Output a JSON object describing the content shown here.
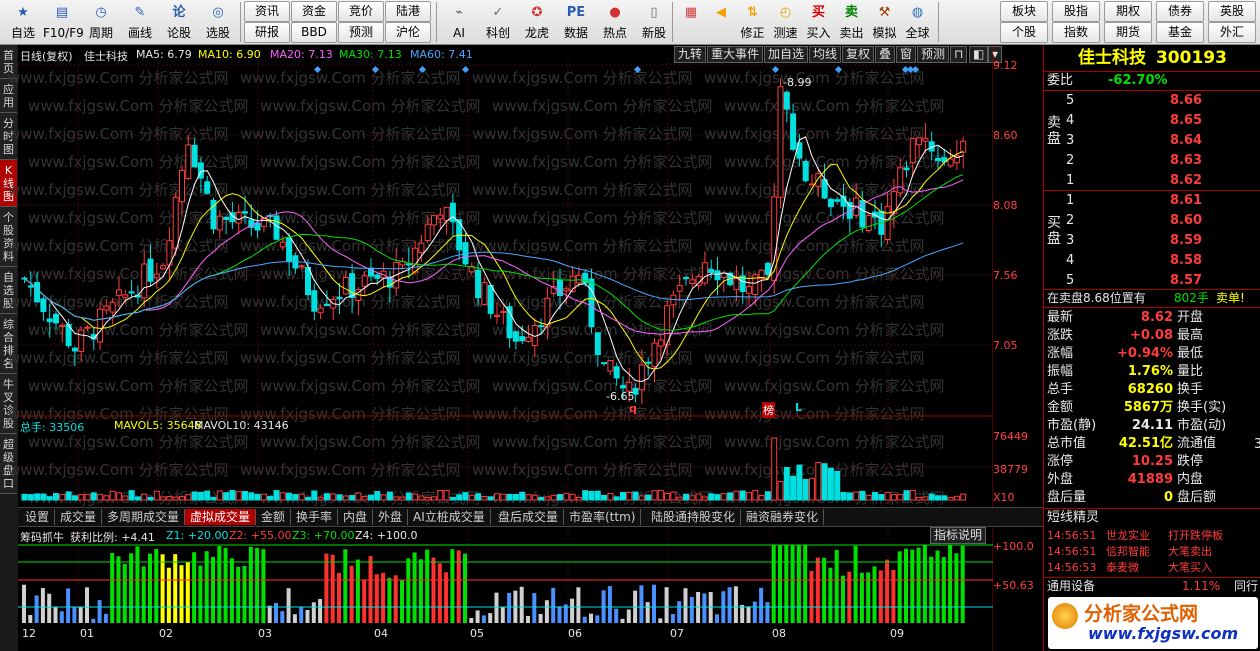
{
  "toolbar": {
    "left_buttons": [
      {
        "label": "自选",
        "icon": "star-icon",
        "sub": ""
      },
      {
        "label": "F10/F9",
        "icon": "f10-icon",
        "sub": ""
      },
      {
        "label": "周期",
        "icon": "clock-icon",
        "sub": ""
      },
      {
        "label": "画线",
        "icon": "pen-icon",
        "sub": ""
      },
      {
        "label": "论股",
        "icon": "discuss-icon",
        "sub": ""
      },
      {
        "label": "选股",
        "icon": "filter-icon",
        "sub": ""
      }
    ],
    "small_buttons": [
      [
        "资讯",
        "资金",
        "竞价",
        "陆港"
      ],
      [
        "研报",
        "BBD",
        "预测",
        "沪伦"
      ]
    ],
    "mid_buttons": [
      {
        "label": "AI",
        "icon": "ai-icon"
      },
      {
        "label": "科创",
        "icon": "kechuang-icon"
      },
      {
        "label": "龙虎",
        "icon": "dragon-tiger-icon"
      },
      {
        "label": "数据",
        "icon": "pe-icon"
      },
      {
        "label": "热点",
        "icon": "hot-icon"
      },
      {
        "label": "新股",
        "icon": "new-stock-icon"
      }
    ],
    "right_buttons": [
      {
        "label": "",
        "icon": "color-grid-icon"
      },
      {
        "label": "",
        "icon": "back-arrow-icon"
      },
      {
        "label": "修正",
        "icon": "up-down-icon"
      },
      {
        "label": "测速",
        "icon": "speed-icon"
      },
      {
        "label": "买入",
        "icon": "buy-icon",
        "glyph": "买"
      },
      {
        "label": "卖出",
        "icon": "sell-icon",
        "glyph": "卖"
      },
      {
        "label": "模拟",
        "icon": "hammer-icon"
      },
      {
        "label": "全球",
        "icon": "globe-icon"
      }
    ],
    "right_small": [
      [
        "板块",
        "股指",
        "期权",
        "债券",
        "英股"
      ],
      [
        "个股",
        "指数",
        "期货",
        "基金",
        "外汇"
      ]
    ]
  },
  "sidebar": {
    "tabs": [
      {
        "label": "首页",
        "active": false
      },
      {
        "label": "应用",
        "active": false
      },
      {
        "label": "分时图",
        "active": false
      },
      {
        "label": "K线图",
        "active": true
      },
      {
        "label": "个股资料",
        "active": false
      },
      {
        "label": "自选股",
        "active": false
      },
      {
        "label": "综合排名",
        "active": false
      },
      {
        "label": "牛叉诊股",
        "active": false
      },
      {
        "label": "超级盘口",
        "active": false
      }
    ]
  },
  "chart": {
    "header": {
      "period": "日线(复权)",
      "stock": "佳士科技",
      "ma5": "MA5: 6.79",
      "ma10": "MA10: 6.90",
      "ma20": "MA20: 7.13",
      "ma30": "MA30: 7.13",
      "ma60": "MA60: 7.41"
    },
    "top_right_tools": [
      "九转",
      "重大事件",
      "加自选",
      "均线",
      "复权",
      "叠",
      "窗",
      "预测"
    ],
    "price_axis": [
      "9.12",
      "8.60",
      "8.08",
      "7.56",
      "7.05"
    ],
    "price_high": "8.99",
    "price_low": "6.65",
    "markers": {
      "q": "q",
      "bang": "榜",
      "L": "L"
    },
    "volume": {
      "total": "总手: 33506",
      "mavol5": "MAVOL5: 35648",
      "mavol10": "MAVOL10: 43146",
      "axis": [
        "76449",
        "38779",
        "X10"
      ]
    },
    "indicator_tabs": [
      "设置",
      "成交量",
      "多周期成交量",
      "虚拟成交量",
      "金额",
      "换手率",
      "内盘",
      "外盘",
      "AI立桩成交量",
      "盘后成交量",
      "市盈率(ttm)",
      "陆股通持股变化",
      "融资融券变化"
    ],
    "active_indicator": "虚拟成交量",
    "indicator": {
      "name": "筹码抓牛",
      "profit": "获利比例: +4.41",
      "z1": "Z1: +20.00",
      "z2": "Z2: +55.00",
      "z3": "Z3: +70.00",
      "z4": "Z4: +100.0",
      "help": "指标说明",
      "axis": [
        "+100.0",
        "+50.63"
      ]
    },
    "months": [
      "12",
      "01",
      "02",
      "03",
      "04",
      "05",
      "06",
      "07",
      "08",
      "09"
    ],
    "watermark": "www.fxjgsw.Com 分析家公式网"
  },
  "quote": {
    "name": "佳士科技",
    "code": "300193",
    "weibi_label": "委比",
    "weibi": "-62.70%",
    "sell_label": "卖盘",
    "buy_label": "买盘",
    "asks": [
      {
        "level": "5",
        "price": "8.66"
      },
      {
        "level": "4",
        "price": "8.65"
      },
      {
        "level": "3",
        "price": "8.64"
      },
      {
        "level": "2",
        "price": "8.63"
      },
      {
        "level": "1",
        "price": "8.62"
      }
    ],
    "bids": [
      {
        "level": "1",
        "price": "8.61"
      },
      {
        "level": "2",
        "price": "8.60"
      },
      {
        "level": "3",
        "price": "8.59"
      },
      {
        "level": "4",
        "price": "8.58"
      },
      {
        "level": "5",
        "price": "8.57"
      }
    ],
    "order_note": "在卖盘8.68位置有",
    "order_qty": "802手",
    "order_tag": "卖单!",
    "stats_left": [
      {
        "label": "最新",
        "value": "8.62",
        "color": "c-red"
      },
      {
        "label": "涨跌",
        "value": "+0.08",
        "color": "c-red"
      },
      {
        "label": "涨幅",
        "value": "+0.94%",
        "color": "c-red"
      },
      {
        "label": "振幅",
        "value": "1.76%",
        "color": "c-yellow"
      },
      {
        "label": "总手",
        "value": "68260",
        "color": "c-yellow"
      },
      {
        "label": "金额",
        "value": "5867万",
        "color": "c-yellow"
      },
      {
        "label": "市盈(静)",
        "value": "24.11",
        "color": "c-white"
      },
      {
        "label": "总市值",
        "value": "42.51亿",
        "color": "c-yellow"
      },
      {
        "label": "涨停",
        "value": "10.25",
        "color": "c-red"
      },
      {
        "label": "外盘",
        "value": "41889",
        "color": "c-red"
      },
      {
        "label": "盘后量",
        "value": "0",
        "color": "c-yellow"
      }
    ],
    "stats_right": [
      "开盘",
      "最高",
      "最低",
      "量比",
      "换手",
      "换手(实)",
      "市盈(动)",
      "流通值",
      "跌停",
      "内盘",
      "盘后额"
    ],
    "stats_right_extra": "3",
    "short_title": "短线精灵",
    "short_items": [
      {
        "time": "14:56:51",
        "name": "世龙实业",
        "event": "打开跌停板"
      },
      {
        "time": "14:56:51",
        "name": "信邦智能",
        "event": "大笔卖出"
      },
      {
        "time": "14:56:53",
        "name": "泰麦微",
        "event": "大笔买入"
      }
    ],
    "sector_label": "通用设备",
    "sector_value": "1.11%",
    "sector_extra": "同行",
    "logo_text": "分析家公式网",
    "logo_url": "www.fxjgsw.com"
  },
  "colors": {
    "up": "#ff3c3c",
    "down": "#00e0e0",
    "ma5": "#ffffff",
    "ma10": "#ffff00",
    "ma20": "#ff60ff",
    "ma30": "#00e000",
    "ma60": "#4fa8ff"
  }
}
